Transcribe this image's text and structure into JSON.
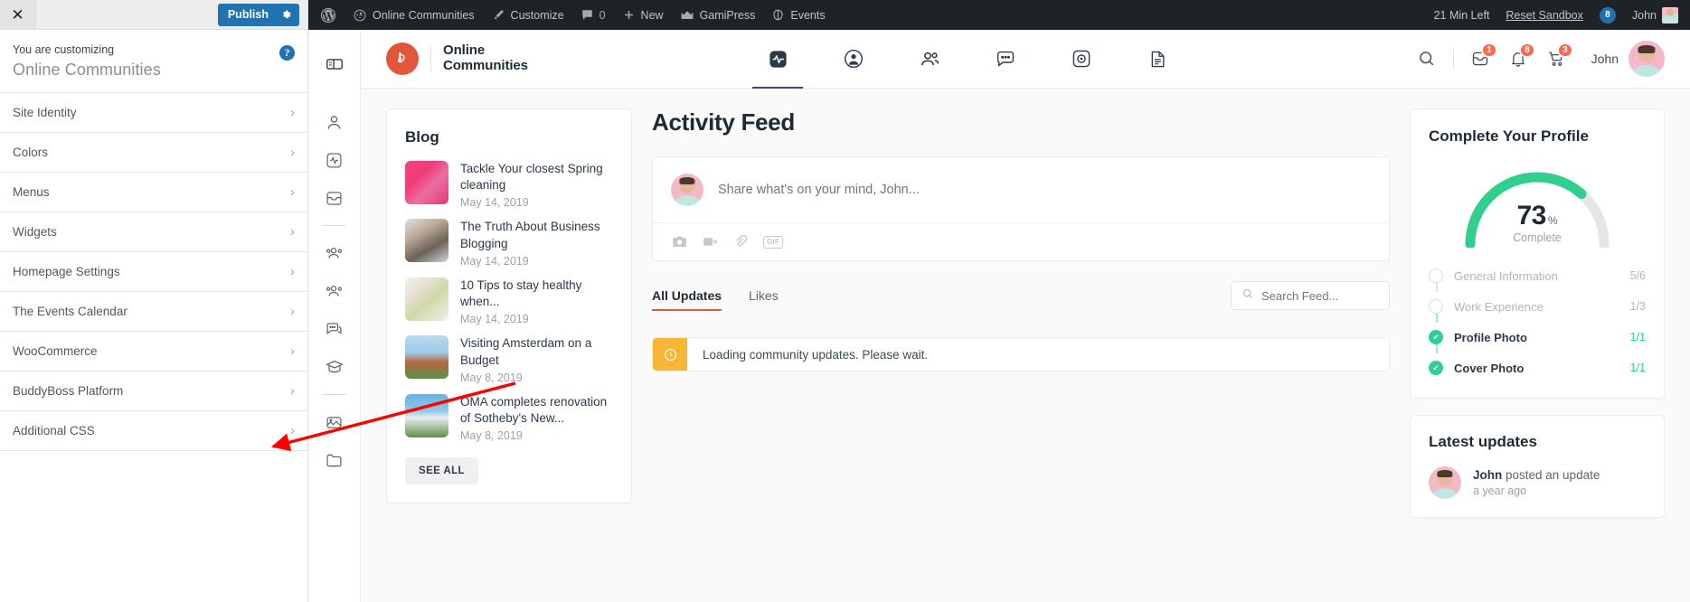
{
  "customizer": {
    "close_label": "✕",
    "publish_label": "Publish",
    "subtitle": "You are customizing",
    "site_title": "Online Communities",
    "help_label": "?",
    "items": [
      {
        "label": "Site Identity"
      },
      {
        "label": "Colors"
      },
      {
        "label": "Menus"
      },
      {
        "label": "Widgets"
      },
      {
        "label": "Homepage Settings"
      },
      {
        "label": "The Events Calendar"
      },
      {
        "label": "WooCommerce"
      },
      {
        "label": "BuddyBoss Platform"
      },
      {
        "label": "Additional CSS"
      }
    ],
    "chevron": "›"
  },
  "adminbar": {
    "left_items": [
      {
        "label": "",
        "icon": "wordpress-icon"
      },
      {
        "label": "Online Communities",
        "icon": "dashboard-icon"
      },
      {
        "label": "Customize",
        "icon": "brush-icon"
      },
      {
        "label": "0",
        "icon": "comment-icon"
      },
      {
        "label": "New",
        "icon": "plus-icon"
      },
      {
        "label": "GamiPress",
        "icon": "crown-icon"
      },
      {
        "label": "Events",
        "icon": "events-icon"
      }
    ],
    "time_left": "21 Min Left",
    "reset_label": "Reset Sandbox",
    "notification_count": "8",
    "username": "John"
  },
  "rail": {
    "items": [
      {
        "name": "sidebar-toggle-icon"
      },
      {
        "name": "profile-icon"
      },
      {
        "name": "activity-icon"
      },
      {
        "name": "inbox-icon"
      },
      {
        "name": "divider"
      },
      {
        "name": "members-icon"
      },
      {
        "name": "groups-icon"
      },
      {
        "name": "forums-icon"
      },
      {
        "name": "courses-icon"
      },
      {
        "name": "divider"
      },
      {
        "name": "media-icon"
      },
      {
        "name": "documents-icon"
      }
    ]
  },
  "site_header": {
    "brand_mark": "b",
    "brand_line1": "Online",
    "brand_line2": "Communities",
    "nav": [
      {
        "name": "nav-activity",
        "icon": "activity-icon",
        "active": true
      },
      {
        "name": "nav-profile",
        "icon": "user-circle-icon",
        "active": false
      },
      {
        "name": "nav-members",
        "icon": "members-icon",
        "active": false
      },
      {
        "name": "nav-messages",
        "icon": "chat-icon",
        "active": false
      },
      {
        "name": "nav-media",
        "icon": "camera-circle-icon",
        "active": false
      },
      {
        "name": "nav-documents",
        "icon": "document-icon",
        "active": false
      }
    ],
    "messages_badge": "1",
    "notifications_badge": "8",
    "cart_badge": "3",
    "username": "John"
  },
  "blog": {
    "title": "Blog",
    "see_all": "SEE ALL",
    "posts": [
      {
        "title": "Tackle Your closest Spring cleaning",
        "date": "May 14, 2019",
        "thumb": "bt-1"
      },
      {
        "title": "The Truth About Business Blogging",
        "date": "May 14, 2019",
        "thumb": "bt-2"
      },
      {
        "title": "10 Tips to stay healthy when...",
        "date": "May 14, 2019",
        "thumb": "bt-3"
      },
      {
        "title": "Visiting Amsterdam on a Budget",
        "date": "May 8, 2019",
        "thumb": "bt-4"
      },
      {
        "title": "OMA completes renovation of Sotheby's New...",
        "date": "May 8, 2019",
        "thumb": "bt-5"
      }
    ]
  },
  "feed": {
    "title": "Activity Feed",
    "composer_placeholder": "Share what's on your mind, John...",
    "composer_actions": [
      {
        "name": "photo-icon"
      },
      {
        "name": "video-icon"
      },
      {
        "name": "attachment-icon"
      },
      {
        "name": "gif-icon",
        "label": "GIF"
      }
    ],
    "tabs": [
      {
        "label": "All Updates",
        "active": true
      },
      {
        "label": "Likes",
        "active": false
      }
    ],
    "search_placeholder": "Search Feed...",
    "search_value": "",
    "notice": "Loading community updates. Please wait."
  },
  "profile": {
    "title": "Complete Your Profile",
    "percent": "73",
    "percent_symbol": "%",
    "complete_label": "Complete",
    "progress_value": 73,
    "steps": [
      {
        "label": "General Information",
        "count": "5/6",
        "done": false
      },
      {
        "label": "Work Experience",
        "count": "1/3",
        "done": false
      },
      {
        "label": "Profile Photo",
        "count": "1/1",
        "done": true
      },
      {
        "label": "Cover Photo",
        "count": "1/1",
        "done": true
      }
    ]
  },
  "latest": {
    "title": "Latest updates",
    "user": "John",
    "action": " posted an update",
    "time": "a year ago"
  },
  "colors": {
    "accent": "#e2563c",
    "wp_blue": "#2271b1",
    "green": "#2ecf8f",
    "badge": "#f26c4f",
    "notice": "#f7b633",
    "annotation": "#ff0000"
  }
}
